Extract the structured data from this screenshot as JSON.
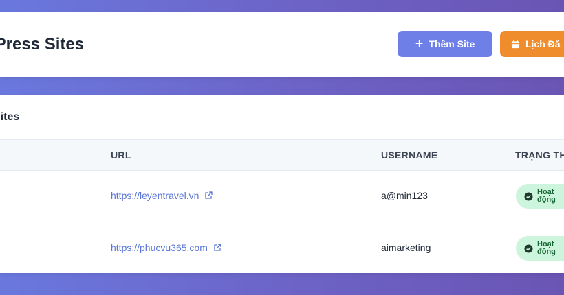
{
  "header": {
    "title": "lPress Sites",
    "add_button_label": "Thêm Site",
    "schedule_button_label": "Lịch Đă"
  },
  "table": {
    "title": "Sites",
    "columns": [
      "URL",
      "USERNAME",
      "TRẠNG TH"
    ],
    "rows": [
      {
        "url": "https://leyentravel.vn",
        "username": "a@min123",
        "status": "Hoạt động"
      },
      {
        "url": "https://phucvu365.com",
        "username": "aimarketing",
        "status": "Hoạt động"
      }
    ]
  },
  "icons": {
    "add": "plus-icon",
    "schedule": "calendar-icon",
    "url": "external-link-icon",
    "status": "check-circle-icon"
  },
  "colors": {
    "background_start": "#6a78dd",
    "background_end": "#6a55b3",
    "primary_button": "#6f7fe8",
    "schedule_button": "#ef8d2c",
    "link": "#5b76d6",
    "status_bg": "#cdf4dc",
    "status_text": "#166534"
  }
}
